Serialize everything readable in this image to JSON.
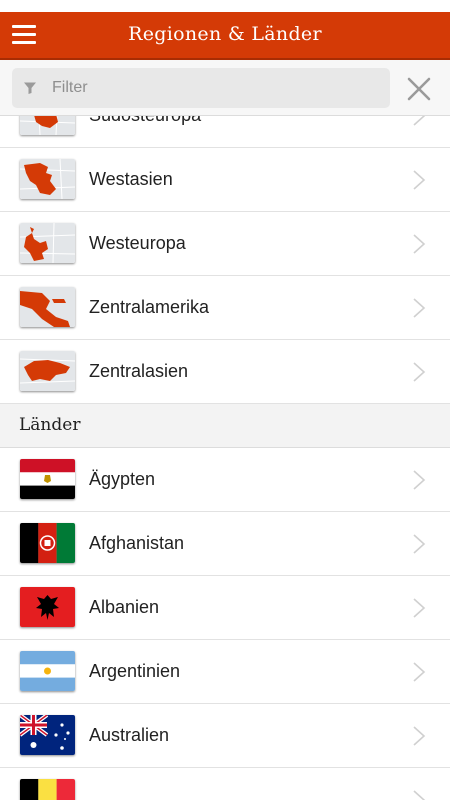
{
  "header": {
    "title": "Regionen & Länder",
    "menu_icon": "hamburger-menu-icon"
  },
  "search": {
    "placeholder": "Filter",
    "value": "",
    "filter_icon": "funnel-icon",
    "clear_icon": "close-icon"
  },
  "regions": [
    {
      "label": "Südosteuropa",
      "icon": "region-map-icon"
    },
    {
      "label": "Westasien",
      "icon": "region-map-icon"
    },
    {
      "label": "Westeuropa",
      "icon": "region-map-icon"
    },
    {
      "label": "Zentralamerika",
      "icon": "region-map-icon"
    },
    {
      "label": "Zentralasien",
      "icon": "region-map-icon"
    }
  ],
  "countries_section": {
    "title": "Länder"
  },
  "countries": [
    {
      "label": "Ägypten",
      "icon": "egypt-flag-icon"
    },
    {
      "label": "Afghanistan",
      "icon": "afghanistan-flag-icon"
    },
    {
      "label": "Albanien",
      "icon": "albania-flag-icon"
    },
    {
      "label": "Argentinien",
      "icon": "argentina-flag-icon"
    },
    {
      "label": "Australien",
      "icon": "australia-flag-icon"
    },
    {
      "label": "",
      "icon": "belgium-flag-icon"
    }
  ],
  "colors": {
    "accent": "#d43a06",
    "text": "#222222",
    "divider": "#e2e2e2"
  }
}
